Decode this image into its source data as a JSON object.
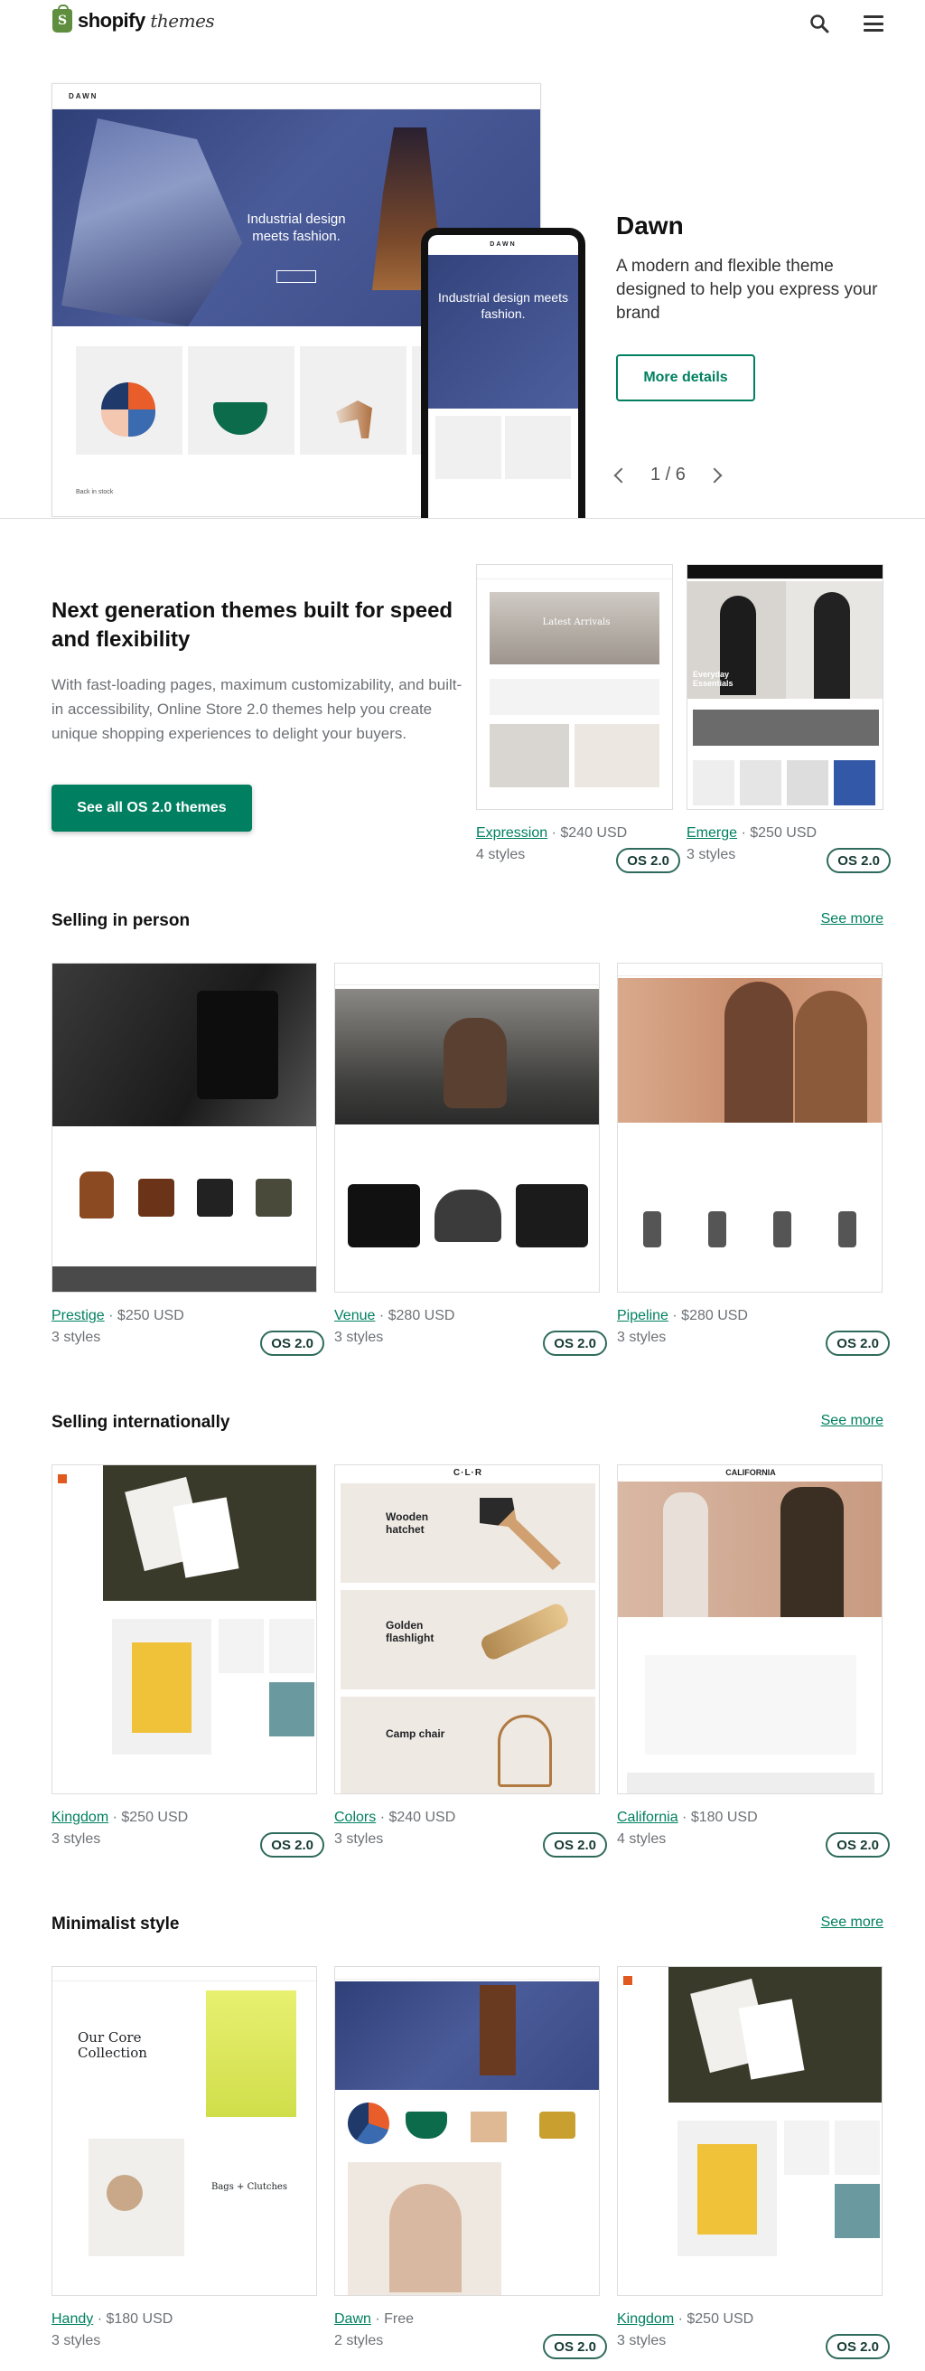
{
  "header": {
    "logo_word": "shopify",
    "logo_suffix": "themes"
  },
  "hero": {
    "theme_name": "Dawn",
    "description": "A modern and flexible theme designed to help you express your brand",
    "cta": "More details",
    "pager": "1 / 6",
    "preview_brand": "DAWN",
    "preview_caption": "Industrial design meets fashion.",
    "preview_back_label": "Back in stock"
  },
  "promo": {
    "title": "Next generation themes built for speed and flexibility",
    "body": "With fast-loading pages, maximum customizability, and built-in accessibility, Online Store 2.0 themes help you create unique shopping experiences to delight your buyers.",
    "cta": "See all OS 2.0 themes",
    "cards": [
      {
        "name": "Expression",
        "price": "· $240 USD",
        "styles": "4 styles",
        "badge": "OS 2.0",
        "preview_title": "Latest Arrivals"
      },
      {
        "name": "Emerge",
        "price": "· $250 USD",
        "styles": "3 styles",
        "badge": "OS 2.0",
        "preview_title": "Everyday Essentials"
      }
    ]
  },
  "sections": [
    {
      "title": "Selling in person",
      "see_more": "See more",
      "cards": [
        {
          "name": "Prestige",
          "price": "· $250 USD",
          "styles": "3 styles",
          "badge": "OS 2.0"
        },
        {
          "name": "Venue",
          "price": "· $280 USD",
          "styles": "3 styles",
          "badge": "OS 2.0"
        },
        {
          "name": "Pipeline",
          "price": "· $280 USD",
          "styles": "3 styles",
          "badge": "OS 2.0"
        }
      ]
    },
    {
      "title": "Selling internationally",
      "see_more": "See more",
      "cards": [
        {
          "name": "Kingdom",
          "price": "· $250 USD",
          "styles": "3 styles",
          "badge": "OS 2.0"
        },
        {
          "name": "Colors",
          "price": "· $240 USD",
          "styles": "3 styles",
          "badge": "OS 2.0"
        },
        {
          "name": "California",
          "price": "· $180 USD",
          "styles": "4 styles",
          "badge": "OS 2.0"
        }
      ]
    },
    {
      "title": "Minimalist style",
      "see_more": "See more",
      "cards": [
        {
          "name": "Handy",
          "price": "· $180 USD",
          "styles": "3 styles",
          "badge": ""
        },
        {
          "name": "Dawn",
          "price": "· Free",
          "styles": "2 styles",
          "badge": "OS 2.0"
        },
        {
          "name": "Kingdom",
          "price": "· $250 USD",
          "styles": "3 styles",
          "badge": "OS 2.0"
        }
      ]
    }
  ],
  "previews": {
    "colors_items": [
      "Wooden hatchet",
      "Golden flashlight",
      "Camp chair"
    ],
    "california_brand": "CALIFORNIA",
    "colors_brand": "C·L·R",
    "handy_heading": "Our Core Collection",
    "handy_sub": "Bags + Clutches"
  },
  "colors": {
    "accent": "#008060",
    "badge_border": "#2f6b5c",
    "text": "#212326",
    "muted": "#6d7175"
  }
}
